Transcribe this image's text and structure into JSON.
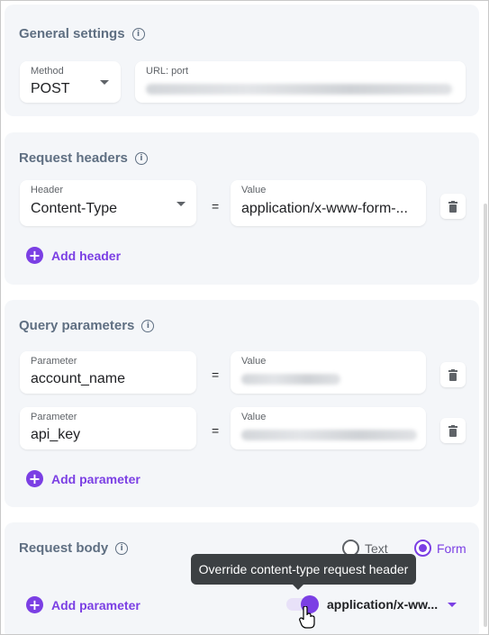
{
  "general": {
    "title": "General settings",
    "method_label": "Method",
    "method_value": "POST",
    "url_label": "URL: port"
  },
  "headers": {
    "title": "Request headers",
    "rows": [
      {
        "header_label": "Header",
        "header_value": "Content-Type",
        "value_label": "Value",
        "value": "application/x-www-form-..."
      }
    ],
    "add_label": "Add header"
  },
  "query": {
    "title": "Query parameters",
    "rows": [
      {
        "param_label": "Parameter",
        "param_value": "account_name",
        "value_label": "Value"
      },
      {
        "param_label": "Parameter",
        "param_value": "api_key",
        "value_label": "Value"
      }
    ],
    "add_label": "Add parameter"
  },
  "body": {
    "title": "Request body",
    "radio_text": "Text",
    "radio_form": "Form",
    "selected": "Form",
    "add_label": "Add parameter",
    "tooltip": "Override content-type request header",
    "content_type_value": "application/x-ww...",
    "override_enabled": true
  },
  "misc": {
    "equals": "="
  },
  "icons": [
    "info-icon",
    "chevron-down-icon",
    "trash-icon",
    "plus-circle-icon",
    "radio-icon",
    "toggle-icon",
    "hand-cursor-icon"
  ],
  "colors": {
    "accent": "#7b3fe4",
    "card_bg": "#f4f6f9",
    "title": "#5f6f82",
    "tooltip_bg": "#3c4043"
  }
}
